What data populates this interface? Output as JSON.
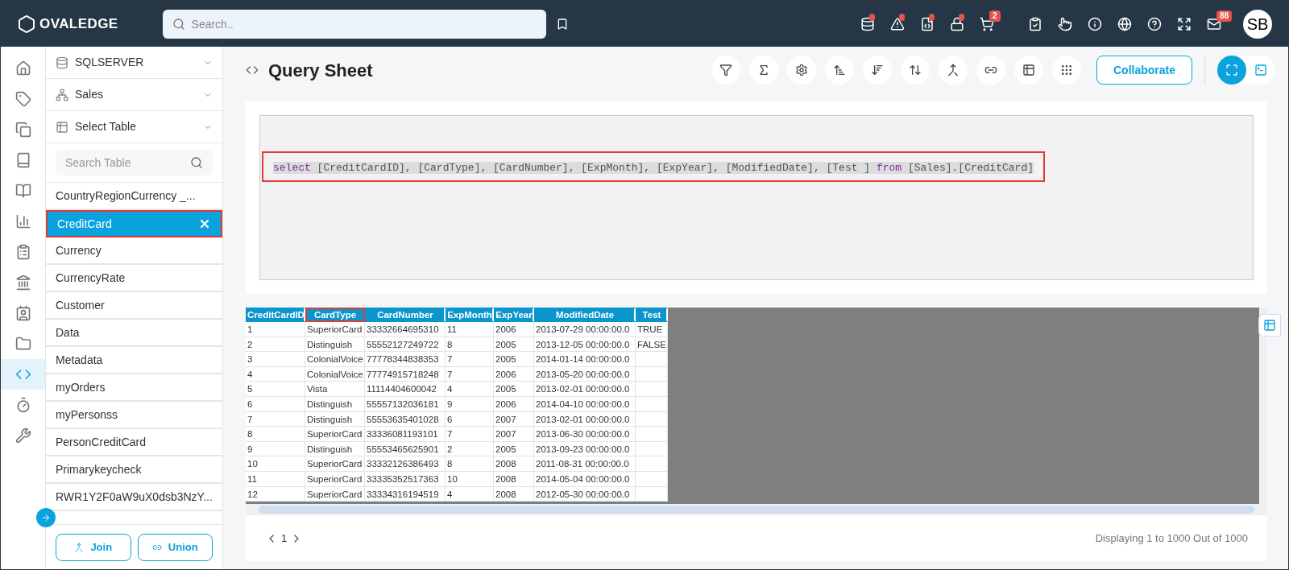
{
  "header": {
    "logo": "OVALEDGE",
    "search_placeholder": "Search..",
    "cart_count": "2",
    "mail_count": "88",
    "avatar": "SB"
  },
  "nav": [
    {
      "kind": "home",
      "selected": false
    },
    {
      "kind": "tag",
      "selected": false
    },
    {
      "kind": "copy",
      "selected": false
    },
    {
      "kind": "book",
      "selected": false
    },
    {
      "kind": "open-book",
      "selected": false
    },
    {
      "kind": "chart",
      "selected": false
    },
    {
      "kind": "clipboard",
      "selected": false
    },
    {
      "kind": "bank",
      "selected": false
    },
    {
      "kind": "contact",
      "selected": false
    },
    {
      "kind": "folder",
      "selected": false
    },
    {
      "kind": "code",
      "selected": true
    },
    {
      "kind": "timer",
      "selected": false
    },
    {
      "kind": "tools",
      "selected": false
    }
  ],
  "source": {
    "connector": "SQLSERVER",
    "schema": "Sales",
    "table_select": "Select Table",
    "search_placeholder": "Search Table"
  },
  "tables": [
    {
      "name": "CountryRegionCurrency _...",
      "selected": false,
      "highlighted": false
    },
    {
      "name": "CreditCard",
      "selected": true,
      "highlighted": true
    },
    {
      "name": "Currency",
      "selected": false,
      "highlighted": false
    },
    {
      "name": "CurrencyRate",
      "selected": false,
      "highlighted": false
    },
    {
      "name": "Customer",
      "selected": false,
      "highlighted": false
    },
    {
      "name": "Data",
      "selected": false,
      "highlighted": false
    },
    {
      "name": "Metadata",
      "selected": false,
      "highlighted": false
    },
    {
      "name": "myOrders",
      "selected": false,
      "highlighted": false
    },
    {
      "name": "myPersonss",
      "selected": false,
      "highlighted": false
    },
    {
      "name": "PersonCreditCard",
      "selected": false,
      "highlighted": false
    },
    {
      "name": "Primarykeycheck",
      "selected": false,
      "highlighted": false
    },
    {
      "name": "RWR1Y2F0aW9uX0dsb3NzY...",
      "selected": false,
      "highlighted": false
    }
  ],
  "actions": [
    {
      "kind": "join",
      "label": "Join"
    },
    {
      "kind": "union",
      "label": "Union"
    }
  ],
  "page": {
    "title": "Query Sheet"
  },
  "toolbar": {
    "collaborate": "Collaborate",
    "views": [
      {
        "kind": "fit",
        "selected": true
      },
      {
        "kind": "console",
        "selected": false
      }
    ]
  },
  "query": {
    "highlighted": true,
    "tokens": [
      {
        "kind": "keyword",
        "text": "select"
      },
      {
        "kind": "text",
        "text": " [CreditCardID], [CardType], [CardNumber], [ExpMonth], [ExpYear], [ModifiedDate], [Test ] "
      },
      {
        "kind": "keyword",
        "text": "from"
      },
      {
        "kind": "text",
        "text": " [Sales].[CreditCard]"
      }
    ]
  },
  "result": {
    "columns": [
      {
        "label": "CreditCardID",
        "highlighted": false
      },
      {
        "label": "CardType",
        "highlighted": true
      },
      {
        "label": "CardNumber",
        "highlighted": false
      },
      {
        "label": "ExpMonth",
        "highlighted": false
      },
      {
        "label": "ExpYear",
        "highlighted": false
      },
      {
        "label": "ModifiedDate",
        "highlighted": false
      },
      {
        "label": "Test",
        "highlighted": false
      }
    ],
    "rows": [
      [
        "1",
        "SuperiorCard",
        "33332664695310",
        "11",
        "2006",
        "2013-07-29 00:00:00.0",
        "TRUE"
      ],
      [
        "2",
        "Distinguish",
        "55552127249722",
        "8",
        "2005",
        "2013-12-05 00:00:00.0",
        "FALSE"
      ],
      [
        "3",
        "ColonialVoice",
        "77778344838353",
        "7",
        "2005",
        "2014-01-14 00:00:00.0",
        ""
      ],
      [
        "4",
        "ColonialVoice",
        "77774915718248",
        "7",
        "2006",
        "2013-05-20 00:00:00.0",
        ""
      ],
      [
        "5",
        "Vista",
        "11114404600042",
        "4",
        "2005",
        "2013-02-01 00:00:00.0",
        ""
      ],
      [
        "6",
        "Distinguish",
        "55557132036181",
        "9",
        "2006",
        "2014-04-10 00:00:00.0",
        ""
      ],
      [
        "7",
        "Distinguish",
        "55553635401028",
        "6",
        "2007",
        "2013-02-01 00:00:00.0",
        ""
      ],
      [
        "8",
        "SuperiorCard",
        "33336081193101",
        "7",
        "2007",
        "2013-06-30 00:00:00.0",
        ""
      ],
      [
        "9",
        "Distinguish",
        "55553465625901",
        "2",
        "2005",
        "2013-09-23 00:00:00.0",
        ""
      ],
      [
        "10",
        "SuperiorCard",
        "33332126386493",
        "8",
        "2008",
        "2011-08-31 00:00:00.0",
        ""
      ],
      [
        "11",
        "SuperiorCard",
        "33335352517363",
        "10",
        "2008",
        "2014-05-04 00:00:00.0",
        ""
      ],
      [
        "12",
        "SuperiorCard",
        "33334316194519",
        "4",
        "2008",
        "2012-05-30 00:00:00.0",
        ""
      ]
    ]
  },
  "pagination": {
    "page": "1",
    "summary": "Displaying 1 to 1000 Out of 1000"
  }
}
